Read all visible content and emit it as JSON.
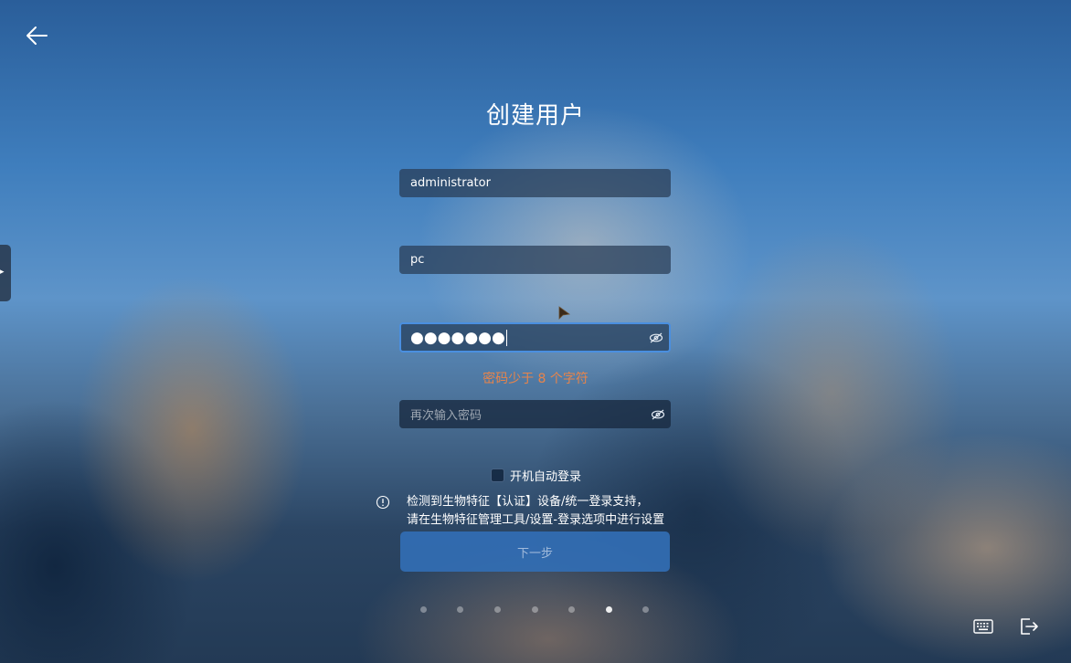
{
  "title": "创建用户",
  "fields": {
    "username": {
      "value": "administrator"
    },
    "hostname": {
      "value": "pc"
    },
    "password": {
      "masked_value": "●●●●●●●"
    },
    "confirm_password": {
      "placeholder": "再次输入密码"
    }
  },
  "password_warning": "密码少于 8 个字符",
  "auto_login_label": "开机自动登录",
  "info_line_1": "检测到生物特征【认证】设备/统一登录支持，",
  "info_line_2": "请在生物特征管理工具/设置-登录选项中进行设置",
  "next_button_label": "下一步",
  "steps": {
    "total": 7,
    "active_index": 5
  },
  "colors": {
    "warning": "#e8844a",
    "focus_border": "#4a8fe0",
    "primary_button": "#326eb4"
  },
  "icons": [
    "back-arrow-icon",
    "eye-hidden-icon",
    "info-icon",
    "keyboard-icon",
    "exit-icon",
    "mouse-cursor-icon",
    "chevron-right-icon"
  ]
}
